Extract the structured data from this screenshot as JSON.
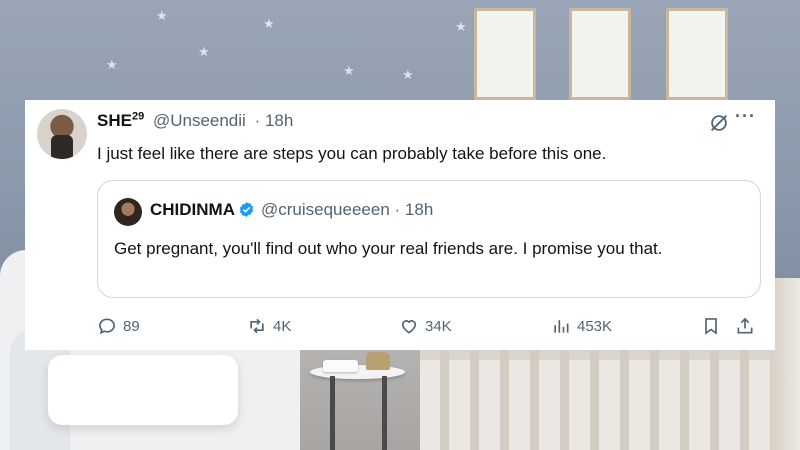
{
  "tweet": {
    "author": {
      "name": "SHE",
      "superscript": "29",
      "handle": "@Unseendii",
      "time": "· 18h"
    },
    "text": "I just feel like there are steps you can probably take before this one.",
    "more_label": "···",
    "quote": {
      "author": {
        "name": "CHIDINMA",
        "handle": "@cruisequeeeen",
        "time": "· 18h"
      },
      "text": "Get pregnant, you'll find out who your real friends are. I promise you that."
    },
    "metrics": {
      "replies": "89",
      "reposts": "4K",
      "likes": "34K",
      "views": "453K"
    }
  },
  "colors": {
    "text": "#0f1419",
    "muted": "#536471",
    "verified": "#1d9bf0",
    "border": "#cfd9de"
  }
}
